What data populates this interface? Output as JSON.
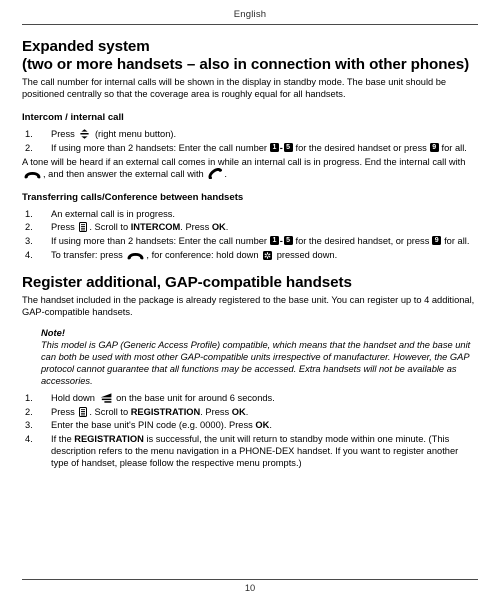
{
  "header": {
    "running_head": "English"
  },
  "sections": [
    {
      "title_line1": "Expanded system",
      "title_line2": "(two or more handsets – also in connection with other phones)",
      "intro": "The call number for internal calls will be shown in the display in standby mode. The base unit should be positioned centrally so that the coverage area is roughly equal for all handsets."
    },
    {
      "title": "Register additional, GAP-compatible handsets",
      "intro": "The handset included in the package is already registered to the base unit. You can register up to 4 additional, GAP-compatible handsets."
    }
  ],
  "subheadings": {
    "intercom": "Intercom / internal call",
    "transferring": "Transferring calls/Conference between handsets"
  },
  "intercom_steps": [
    {
      "num": "1.",
      "parts": [
        {
          "t": "text",
          "v": "Press "
        },
        {
          "t": "icon",
          "v": "menu-updown-icon"
        },
        {
          "t": "text",
          "v": " (right menu button)."
        }
      ]
    },
    {
      "num": "2.",
      "parts": [
        {
          "t": "text",
          "v": "If using more than 2 handsets: Enter the call number "
        },
        {
          "t": "key",
          "v": "1"
        },
        {
          "t": "dash",
          "v": "-"
        },
        {
          "t": "key",
          "v": "5"
        },
        {
          "t": "text",
          "v": " for the desired handset or press "
        },
        {
          "t": "key",
          "v": "9"
        },
        {
          "t": "text",
          "v": " for all."
        }
      ]
    }
  ],
  "intercom_note": {
    "parts": [
      {
        "t": "text",
        "v": "A tone will be heard if an external call comes in while an internal call is in progress. End the internal call with "
      },
      {
        "t": "icon",
        "v": "hangup-handset-icon"
      },
      {
        "t": "text",
        "v": ", and then answer the external call with "
      },
      {
        "t": "icon",
        "v": "answer-handset-icon"
      },
      {
        "t": "text",
        "v": "."
      }
    ]
  },
  "transferring_steps": [
    {
      "num": "1.",
      "parts": [
        {
          "t": "text",
          "v": "An external call is in progress."
        }
      ]
    },
    {
      "num": "2.",
      "parts": [
        {
          "t": "text",
          "v": "Press "
        },
        {
          "t": "icon",
          "v": "menu-list-icon"
        },
        {
          "t": "text",
          "v": ". Scroll to "
        },
        {
          "t": "bold",
          "v": "INTERCOM"
        },
        {
          "t": "text",
          "v": ". Press "
        },
        {
          "t": "bold",
          "v": "OK"
        },
        {
          "t": "text",
          "v": "."
        }
      ]
    },
    {
      "num": "3.",
      "parts": [
        {
          "t": "text",
          "v": "If using more than 2 handsets: Enter the call number "
        },
        {
          "t": "key",
          "v": "1"
        },
        {
          "t": "dash",
          "v": "-"
        },
        {
          "t": "key",
          "v": "5"
        },
        {
          "t": "text",
          "v": " for the desired handset, or press "
        },
        {
          "t": "key",
          "v": "9"
        },
        {
          "t": "text",
          "v": " for all."
        }
      ]
    },
    {
      "num": "4.",
      "parts": [
        {
          "t": "text",
          "v": "To transfer: press "
        },
        {
          "t": "icon",
          "v": "hangup-handset-icon"
        },
        {
          "t": "text",
          "v": ", for conference: hold down "
        },
        {
          "t": "icon",
          "v": "star-key-icon"
        },
        {
          "t": "text",
          "v": " pressed down."
        }
      ]
    }
  ],
  "note": {
    "title": "Note!",
    "body": "This model is GAP (Generic Access Profile) compatible, which means that the handset and the base unit can both be used with most other GAP-compatible units irrespective of manufacturer. However, the GAP protocol cannot guarantee that all functions may be accessed. Extra handsets will not be available as accessories."
  },
  "registration_steps": [
    {
      "num": "1.",
      "parts": [
        {
          "t": "text",
          "v": "Hold down "
        },
        {
          "t": "icon",
          "v": "paging-antenna-icon"
        },
        {
          "t": "text",
          "v": " on the base unit for around 6 seconds."
        }
      ]
    },
    {
      "num": "2.",
      "parts": [
        {
          "t": "text",
          "v": "Press "
        },
        {
          "t": "icon",
          "v": "menu-list-icon"
        },
        {
          "t": "text",
          "v": ". Scroll to "
        },
        {
          "t": "bold",
          "v": "REGISTRATION"
        },
        {
          "t": "text",
          "v": ". Press "
        },
        {
          "t": "bold",
          "v": "OK"
        },
        {
          "t": "text",
          "v": "."
        }
      ]
    },
    {
      "num": "3.",
      "parts": [
        {
          "t": "text",
          "v": "Enter the base unit's PIN code (e.g. 0000). Press "
        },
        {
          "t": "bold",
          "v": "OK"
        },
        {
          "t": "text",
          "v": "."
        }
      ]
    },
    {
      "num": "4.",
      "parts": [
        {
          "t": "text",
          "v": "If the "
        },
        {
          "t": "bold",
          "v": "REGISTRATION"
        },
        {
          "t": "text",
          "v": " is successful, the unit will return to standby mode within one minute. (This description refers to the menu navigation in a PHONE-DEX handset. If you want to register another type of handset, please follow the respective menu prompts.)"
        }
      ]
    }
  ],
  "footer": {
    "page_number": "10"
  },
  "colors": {
    "text": "#000000",
    "rule": "#4a4a4a",
    "keycap_bg": "#000000",
    "keycap_fg": "#ffffff"
  }
}
